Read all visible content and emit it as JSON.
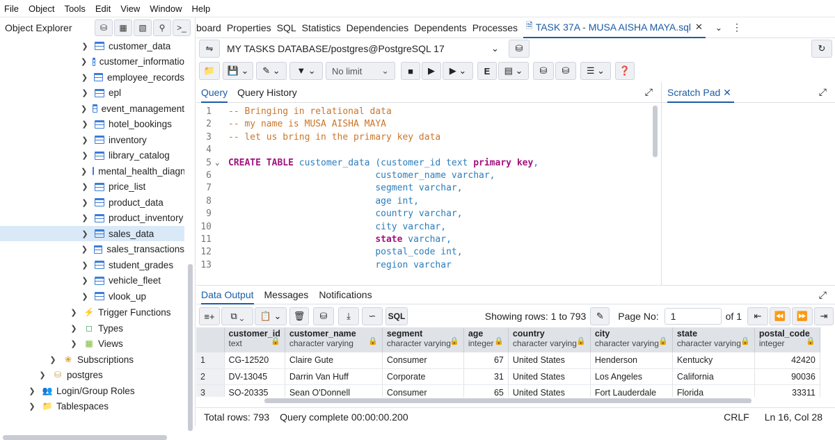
{
  "menu": [
    "File",
    "Object",
    "Tools",
    "Edit",
    "View",
    "Window",
    "Help"
  ],
  "object_explorer": {
    "title": "Object Explorer",
    "tables": [
      "customer_data",
      "customer_informatio",
      "employee_records",
      "epl",
      "event_management",
      "hotel_bookings",
      "inventory",
      "library_catalog",
      "mental_health_diagno",
      "price_list",
      "product_data",
      "product_inventory",
      "sales_data",
      "sales_transactions",
      "student_grades",
      "vehicle_fleet",
      "vlook_up"
    ],
    "selected": "sales_data",
    "groups": [
      "Trigger Functions",
      "Types",
      "Views",
      "Subscriptions",
      "postgres",
      "Login/Group Roles",
      "Tablespaces"
    ]
  },
  "tabs": [
    "board",
    "Properties",
    "SQL",
    "Statistics",
    "Dependencies",
    "Dependents",
    "Processes",
    "TASK 37A - MUSA AISHA MAYA.sql"
  ],
  "active_tab": "TASK 37A - MUSA AISHA MAYA.sql",
  "connection": "MY TASKS DATABASE/postgres@PostgreSQL 17",
  "limit": "No limit",
  "query_tabs": [
    "Query",
    "Query History"
  ],
  "scratch_pad": "Scratch Pad",
  "code_lines": [
    {
      "n": "1",
      "parts": [
        {
          "t": "-- Bringing in relational data",
          "c": "cm"
        }
      ]
    },
    {
      "n": "2",
      "parts": [
        {
          "t": "-- my name is MUSA AISHA MAYA",
          "c": "cm"
        }
      ]
    },
    {
      "n": "3",
      "parts": [
        {
          "t": "-- let us bring in the primary key data",
          "c": "cm"
        }
      ]
    },
    {
      "n": "4",
      "parts": []
    },
    {
      "n": "5",
      "parts": [
        {
          "t": "CREATE TABLE",
          "c": "kw"
        },
        {
          "t": " customer_data (customer_id text ",
          "c": ""
        },
        {
          "t": "primary key",
          "c": "kw"
        },
        {
          "t": ",",
          "c": ""
        }
      ]
    },
    {
      "n": "6",
      "parts": [
        {
          "t": "                           customer_name varchar,",
          "c": ""
        }
      ]
    },
    {
      "n": "7",
      "parts": [
        {
          "t": "                           segment varchar,",
          "c": ""
        }
      ]
    },
    {
      "n": "8",
      "parts": [
        {
          "t": "                           age int,",
          "c": ""
        }
      ]
    },
    {
      "n": "9",
      "parts": [
        {
          "t": "                           country varchar,",
          "c": ""
        }
      ]
    },
    {
      "n": "10",
      "parts": [
        {
          "t": "                           city varchar,",
          "c": ""
        }
      ]
    },
    {
      "n": "11",
      "parts": [
        {
          "t": "                           ",
          "c": ""
        },
        {
          "t": "state",
          "c": "kw"
        },
        {
          "t": " varchar,",
          "c": ""
        }
      ]
    },
    {
      "n": "12",
      "parts": [
        {
          "t": "                           postal_code int,",
          "c": ""
        }
      ]
    },
    {
      "n": "13",
      "parts": [
        {
          "t": "                           region varchar",
          "c": ""
        }
      ]
    }
  ],
  "data_tabs": [
    "Data Output",
    "Messages",
    "Notifications"
  ],
  "showing_rows": "Showing rows: 1 to 793",
  "page_no_label": "Page No:",
  "page_no": "1",
  "of_pages": "of 1",
  "columns": [
    {
      "name": "customer_id",
      "type": "text"
    },
    {
      "name": "customer_name",
      "type": "character varying"
    },
    {
      "name": "segment",
      "type": "character varying"
    },
    {
      "name": "age",
      "type": "integer"
    },
    {
      "name": "country",
      "type": "character varying"
    },
    {
      "name": "city",
      "type": "character varying"
    },
    {
      "name": "state",
      "type": "character varying"
    },
    {
      "name": "postal_code",
      "type": "integer"
    }
  ],
  "rows": [
    [
      "1",
      "CG-12520",
      "Claire Gute",
      "Consumer",
      "67",
      "United States",
      "Henderson",
      "Kentucky",
      "42420"
    ],
    [
      "2",
      "DV-13045",
      "Darrin Van Huff",
      "Corporate",
      "31",
      "United States",
      "Los Angeles",
      "California",
      "90036"
    ],
    [
      "3",
      "SO-20335",
      "Sean O'Donnell",
      "Consumer",
      "65",
      "United States",
      "Fort Lauderdale",
      "Florida",
      "33311"
    ]
  ],
  "status": {
    "total_rows": "Total rows: 793",
    "query_complete": "Query complete 00:00:00.200",
    "eol": "CRLF",
    "position": "Ln 16, Col 28"
  }
}
